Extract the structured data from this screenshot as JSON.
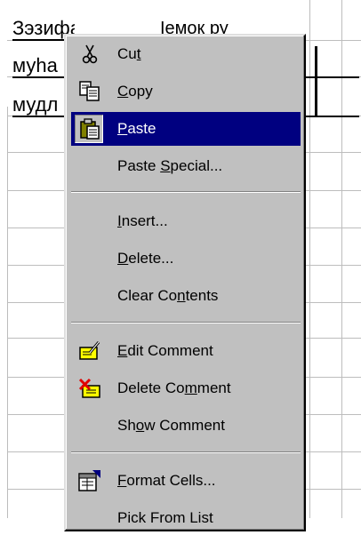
{
  "sheet": {
    "row1_text": "Зэзифа",
    "row1_right_text": "Ӏемок ру",
    "row2_text": "муһа",
    "row3_text": "мудл"
  },
  "menu": {
    "items": [
      {
        "pre": "Cu",
        "mn": "t",
        "post": "",
        "icon": "scissors-icon"
      },
      {
        "pre": "",
        "mn": "C",
        "post": "opy",
        "icon": "copy-icon"
      },
      {
        "pre": "",
        "mn": "P",
        "post": "aste",
        "icon": "paste-icon"
      },
      {
        "pre": "Paste ",
        "mn": "S",
        "post": "pecial...",
        "icon": ""
      },
      {
        "pre": "",
        "mn": "I",
        "post": "nsert...",
        "icon": ""
      },
      {
        "pre": "",
        "mn": "D",
        "post": "elete...",
        "icon": ""
      },
      {
        "pre": "Clear Co",
        "mn": "n",
        "post": "tents",
        "icon": ""
      },
      {
        "pre": "",
        "mn": "E",
        "post": "dit Comment",
        "icon": "edit-comment-icon"
      },
      {
        "pre": "Delete Co",
        "mn": "m",
        "post": "ment",
        "icon": "delete-comment-icon"
      },
      {
        "pre": "Sh",
        "mn": "o",
        "post": "w Comment",
        "icon": ""
      },
      {
        "pre": "",
        "mn": "F",
        "post": "ormat Cells...",
        "icon": "format-cells-icon"
      },
      {
        "pre": "Pick From List",
        "mn": "",
        "post": "",
        "icon": ""
      }
    ],
    "selected_index": 2
  },
  "colors": {
    "highlight": "#000080",
    "menu_face": "#c0c0c0"
  }
}
